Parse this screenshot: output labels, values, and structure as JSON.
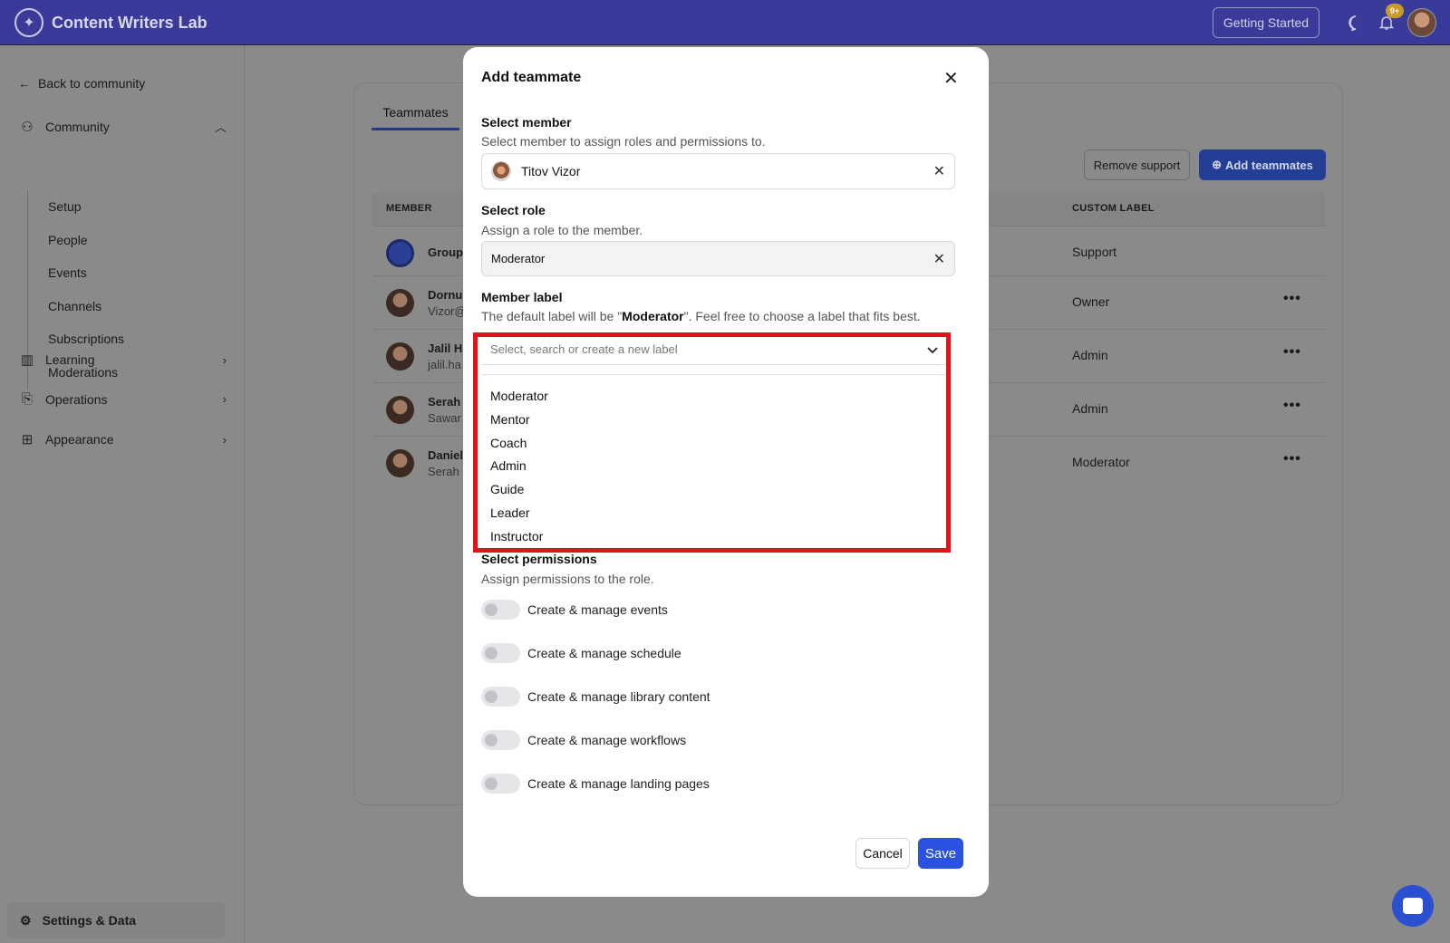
{
  "app": {
    "name": "Content Writers Lab",
    "getting_started": "Getting Started",
    "notification_count": "9+"
  },
  "sidebar": {
    "back_label": "Back to community",
    "community_label": "Community",
    "community_items": [
      "Setup",
      "People",
      "Events",
      "Channels",
      "Subscriptions",
      "Moderations"
    ],
    "learning_label": "Learning",
    "operations_label": "Operations",
    "appearance_label": "Appearance",
    "settings_label": "Settings & Data"
  },
  "main": {
    "tab_label": "Teammates",
    "remove_support": "Remove support",
    "add_teammates": "Add teammates",
    "col_member": "MEMBER",
    "col_custom_label": "CUSTOM LABEL",
    "rows": [
      {
        "name": "Group",
        "sub": "",
        "label": "Support"
      },
      {
        "name": "Dornu",
        "sub": "Vizor@",
        "label": "Owner"
      },
      {
        "name": "Jalil H",
        "sub": "jalil.ha",
        "label": "Admin"
      },
      {
        "name": "Serah",
        "sub": "Sawar",
        "label": "Admin"
      },
      {
        "name": "Daniel",
        "sub": "Serah",
        "label": "Moderator"
      }
    ]
  },
  "modal": {
    "title": "Add teammate",
    "member": {
      "title": "Select member",
      "desc": "Select member to assign roles and permissions to.",
      "value": "Titov Vizor"
    },
    "role": {
      "title": "Select role",
      "desc": "Assign a role to the member.",
      "value": "Moderator"
    },
    "label": {
      "title": "Member label",
      "desc_prefix": "The default label will be \"",
      "desc_bold": "Moderator",
      "desc_suffix": "\". Feel free to choose a label that fits best.",
      "placeholder": "Select, search or create a new label",
      "options": [
        "Moderator",
        "Mentor",
        "Coach",
        "Admin",
        "Guide",
        "Leader",
        "Instructor"
      ]
    },
    "permissions": {
      "title": "Select permissions",
      "desc": "Assign permissions to the role.",
      "items": [
        "Create & manage events",
        "Create & manage schedule",
        "Create & manage library content",
        "Create & manage workflows",
        "Create & manage landing pages"
      ]
    },
    "cancel": "Cancel",
    "save": "Save"
  },
  "colors": {
    "topbar": "#3a3a9a",
    "accent": "#2952e0",
    "highlight": "#e0141a"
  }
}
